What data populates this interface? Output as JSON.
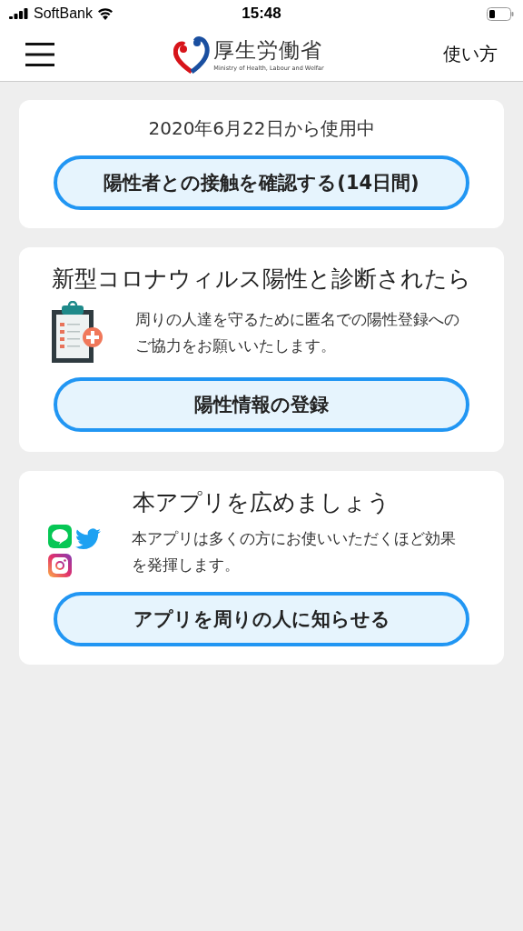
{
  "status_bar": {
    "carrier": "SoftBank",
    "time": "15:48"
  },
  "header": {
    "logo_title": "厚生労働省",
    "logo_subtitle": "Ministry of Health, Labour and Welfar",
    "help_link": "使い方"
  },
  "cards": [
    {
      "kind": "usage",
      "text": "2020年6月22日から使用中",
      "button": "陽性者との接触を確認する(14日間)"
    },
    {
      "kind": "register",
      "title": "新型コロナウィルス陽性と診断されたら",
      "text": "周りの人達を守るために匿名での陽性登録へのご協力をお願いいたします。",
      "button": "陽性情報の登録"
    },
    {
      "kind": "share",
      "title": "本アプリを広めましょう",
      "text": "本アプリは多くの方にお使いいただくほど効果を発揮します。",
      "button": "アプリを周りの人に知らせる"
    }
  ]
}
